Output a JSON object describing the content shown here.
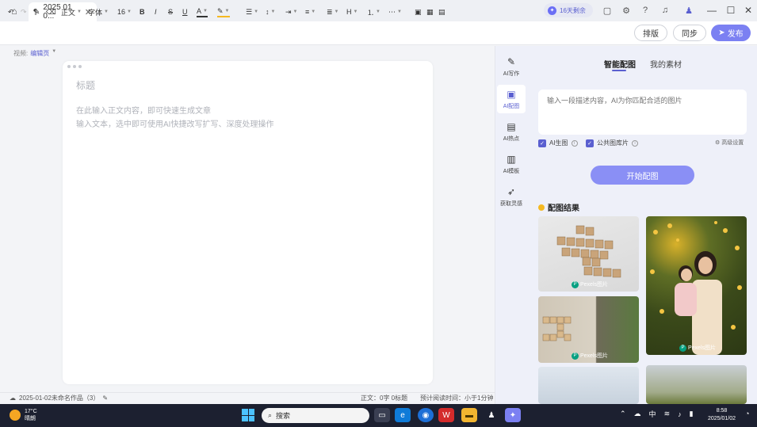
{
  "titlebar": {
    "tab_title": "2025 01 0...",
    "ai_credit": "16天剩余"
  },
  "toolbar": {
    "paragraph": "正文",
    "font": "字体",
    "size": "16",
    "typeset_label": "排版",
    "sync_label": "同步",
    "publish_label": "发布"
  },
  "editor": {
    "doc_type_label": "视频:",
    "doc_type_value": "编辑页",
    "title_placeholder": "标题",
    "body_placeholder_1": "在此输入正文内容，即可快速生成文章",
    "body_placeholder_2": "输入文本，选中即可使用AI快捷改写扩写、深度处理操作"
  },
  "statusbar": {
    "save_status": "2025-01-02未命名作品（3）",
    "word_count": "正文：0字  0标题",
    "read_time": "预计阅读时间：小于1分钟"
  },
  "rail": [
    {
      "label": "AI写作",
      "icon": "pen-icon"
    },
    {
      "label": "AI配图",
      "icon": "image-icon"
    },
    {
      "label": "AI热点",
      "icon": "trend-icon"
    },
    {
      "label": "AI模板",
      "icon": "template-icon"
    },
    {
      "label": "获取灵感",
      "icon": "rocket-icon"
    }
  ],
  "panel": {
    "tab_smart": "智能配图",
    "tab_material": "我的素材",
    "prompt_placeholder": "输入一段描述内容，AI为你匹配合适的图片",
    "check_ai": "AI生图",
    "check_public": "公共图库片",
    "advanced": "高级设置",
    "start_button": "开始配图",
    "results_title": "配图结果",
    "credit_1": "Pexels图片",
    "credit_2": "Pexels图片",
    "credit_3": "Pexels图片"
  },
  "taskbar": {
    "temp": "17°C",
    "weather": "晴朗",
    "search": "搜索",
    "ime": "中",
    "time": "8:58",
    "date": "2025/01/02"
  },
  "colors": {
    "accent": "#7b80f2",
    "accent_text": "#5a5fd0"
  }
}
